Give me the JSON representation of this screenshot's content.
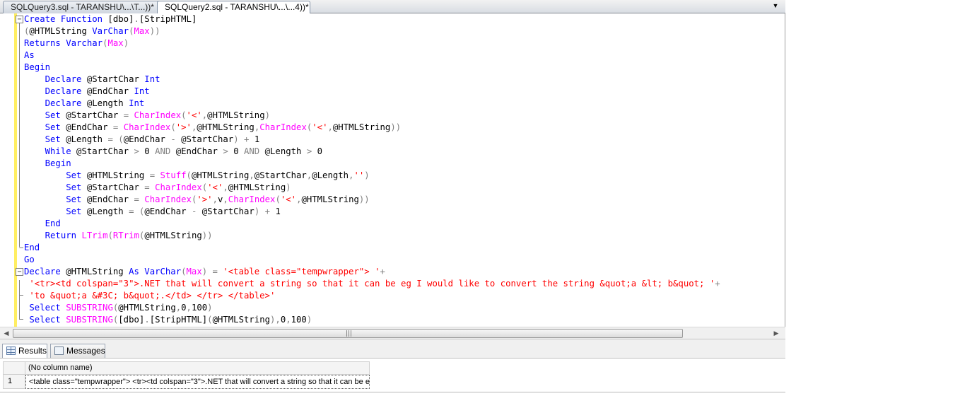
{
  "tabs": [
    {
      "label": "SQLQuery3.sql - TARANSHU\\...\\T...))*",
      "active": false
    },
    {
      "label": "SQLQuery2.sql - TARANSHU\\...\\...4))*",
      "active": true
    }
  ],
  "tab_dropdown": "▼",
  "code_lines": [
    [
      [
        "kw",
        "Create Function "
      ],
      [
        "tx",
        "[dbo]"
      ],
      [
        "op",
        "."
      ],
      [
        "tx",
        "[StripHTML]"
      ]
    ],
    [
      [
        "op",
        "("
      ],
      [
        "tx",
        "@HTMLString "
      ],
      [
        "kw",
        "VarChar"
      ],
      [
        "op",
        "("
      ],
      [
        "fn",
        "Max"
      ],
      [
        "op",
        "))"
      ]
    ],
    [
      [
        "kw",
        "Returns Varchar"
      ],
      [
        "op",
        "("
      ],
      [
        "fn",
        "Max"
      ],
      [
        "op",
        ")"
      ]
    ],
    [
      [
        "kw",
        "As"
      ]
    ],
    [
      [
        "kw",
        "Begin"
      ]
    ],
    [
      [
        "tx",
        "    "
      ],
      [
        "kw",
        "Declare "
      ],
      [
        "tx",
        "@StartChar "
      ],
      [
        "kw",
        "Int"
      ]
    ],
    [
      [
        "tx",
        "    "
      ],
      [
        "kw",
        "Declare "
      ],
      [
        "tx",
        "@EndChar "
      ],
      [
        "kw",
        "Int"
      ]
    ],
    [
      [
        "tx",
        "    "
      ],
      [
        "kw",
        "Declare "
      ],
      [
        "tx",
        "@Length "
      ],
      [
        "kw",
        "Int"
      ]
    ],
    [
      [
        "tx",
        "    "
      ],
      [
        "kw",
        "Set "
      ],
      [
        "tx",
        "@StartChar "
      ],
      [
        "op",
        "= "
      ],
      [
        "fn",
        "CharIndex"
      ],
      [
        "op",
        "("
      ],
      [
        "str",
        "'<'"
      ],
      [
        "op",
        ","
      ],
      [
        "tx",
        "@HTMLString"
      ],
      [
        "op",
        ")"
      ]
    ],
    [
      [
        "tx",
        "    "
      ],
      [
        "kw",
        "Set "
      ],
      [
        "tx",
        "@EndChar "
      ],
      [
        "op",
        "= "
      ],
      [
        "fn",
        "CharIndex"
      ],
      [
        "op",
        "("
      ],
      [
        "str",
        "'>'"
      ],
      [
        "op",
        ","
      ],
      [
        "tx",
        "@HTMLString"
      ],
      [
        "op",
        ","
      ],
      [
        "fn",
        "CharIndex"
      ],
      [
        "op",
        "("
      ],
      [
        "str",
        "'<'"
      ],
      [
        "op",
        ","
      ],
      [
        "tx",
        "@HTMLString"
      ],
      [
        "op",
        "))"
      ]
    ],
    [
      [
        "tx",
        "    "
      ],
      [
        "kw",
        "Set "
      ],
      [
        "tx",
        "@Length "
      ],
      [
        "op",
        "= ("
      ],
      [
        "tx",
        "@EndChar "
      ],
      [
        "op",
        "- "
      ],
      [
        "tx",
        "@StartChar"
      ],
      [
        "op",
        ") + "
      ],
      [
        "tx",
        "1"
      ]
    ],
    [
      [
        "tx",
        "    "
      ],
      [
        "kw",
        "While "
      ],
      [
        "tx",
        "@StartChar "
      ],
      [
        "op",
        "> "
      ],
      [
        "tx",
        "0 "
      ],
      [
        "op",
        "AND "
      ],
      [
        "tx",
        "@EndChar "
      ],
      [
        "op",
        "> "
      ],
      [
        "tx",
        "0 "
      ],
      [
        "op",
        "AND "
      ],
      [
        "tx",
        "@Length "
      ],
      [
        "op",
        "> "
      ],
      [
        "tx",
        "0"
      ]
    ],
    [
      [
        "tx",
        "    "
      ],
      [
        "kw",
        "Begin"
      ]
    ],
    [
      [
        "tx",
        "        "
      ],
      [
        "kw",
        "Set "
      ],
      [
        "tx",
        "@HTMLString "
      ],
      [
        "op",
        "= "
      ],
      [
        "fn",
        "Stuff"
      ],
      [
        "op",
        "("
      ],
      [
        "tx",
        "@HTMLString"
      ],
      [
        "op",
        ","
      ],
      [
        "tx",
        "@StartChar"
      ],
      [
        "op",
        ","
      ],
      [
        "tx",
        "@Length"
      ],
      [
        "op",
        ","
      ],
      [
        "str",
        "''"
      ],
      [
        "op",
        ")"
      ]
    ],
    [
      [
        "tx",
        "        "
      ],
      [
        "kw",
        "Set "
      ],
      [
        "tx",
        "@StartChar "
      ],
      [
        "op",
        "= "
      ],
      [
        "fn",
        "CharIndex"
      ],
      [
        "op",
        "("
      ],
      [
        "str",
        "'<'"
      ],
      [
        "op",
        ","
      ],
      [
        "tx",
        "@HTMLString"
      ],
      [
        "op",
        ")"
      ]
    ],
    [
      [
        "tx",
        "        "
      ],
      [
        "kw",
        "Set "
      ],
      [
        "tx",
        "@EndChar "
      ],
      [
        "op",
        "= "
      ],
      [
        "fn",
        "CharIndex"
      ],
      [
        "op",
        "("
      ],
      [
        "str",
        "'>'"
      ],
      [
        "op",
        ","
      ],
      [
        "tx",
        "v"
      ],
      [
        "op",
        ","
      ],
      [
        "fn",
        "CharIndex"
      ],
      [
        "op",
        "("
      ],
      [
        "str",
        "'<'"
      ],
      [
        "op",
        ","
      ],
      [
        "tx",
        "@HTMLString"
      ],
      [
        "op",
        "))"
      ]
    ],
    [
      [
        "tx",
        "        "
      ],
      [
        "kw",
        "Set "
      ],
      [
        "tx",
        "@Length "
      ],
      [
        "op",
        "= ("
      ],
      [
        "tx",
        "@EndChar "
      ],
      [
        "op",
        "- "
      ],
      [
        "tx",
        "@StartChar"
      ],
      [
        "op",
        ") + "
      ],
      [
        "tx",
        "1"
      ]
    ],
    [
      [
        "tx",
        "    "
      ],
      [
        "kw",
        "End"
      ]
    ],
    [
      [
        "tx",
        "    "
      ],
      [
        "kw",
        "Return "
      ],
      [
        "fn",
        "LTrim"
      ],
      [
        "op",
        "("
      ],
      [
        "fn",
        "RTrim"
      ],
      [
        "op",
        "("
      ],
      [
        "tx",
        "@HTMLString"
      ],
      [
        "op",
        "))"
      ]
    ],
    [
      [
        "kw",
        "End"
      ]
    ],
    [
      [
        "kw",
        "Go"
      ]
    ],
    [
      [
        "kw",
        "Declare "
      ],
      [
        "tx",
        "@HTMLString "
      ],
      [
        "kw",
        "As VarChar"
      ],
      [
        "op",
        "("
      ],
      [
        "fn",
        "Max"
      ],
      [
        "op",
        ") = "
      ],
      [
        "str",
        "'<table class=\"tempwrapper\"> '"
      ],
      [
        "op",
        "+"
      ]
    ],
    [
      [
        "tx",
        " "
      ],
      [
        "str",
        "'<tr><td colspan=\"3\">.NET that will convert a string so that it can be eg I would like to convert the string &quot;a &lt; b&quot; '"
      ],
      [
        "op",
        "+"
      ]
    ],
    [
      [
        "tx",
        " "
      ],
      [
        "str",
        "'to &quot;a &#3C; b&quot;.</td> </tr> </table>'"
      ]
    ],
    [
      [
        "tx",
        " "
      ],
      [
        "kw",
        "Select "
      ],
      [
        "fn",
        "SUBSTRING"
      ],
      [
        "op",
        "("
      ],
      [
        "tx",
        "@HTMLString"
      ],
      [
        "op",
        ","
      ],
      [
        "tx",
        "0"
      ],
      [
        "op",
        ","
      ],
      [
        "tx",
        "100"
      ],
      [
        "op",
        ")"
      ]
    ],
    [
      [
        "tx",
        " "
      ],
      [
        "kw",
        "Select "
      ],
      [
        "fn",
        "SUBSTRING"
      ],
      [
        "op",
        "("
      ],
      [
        "tx",
        "[dbo]"
      ],
      [
        "op",
        "."
      ],
      [
        "tx",
        "[StripHTML]"
      ],
      [
        "op",
        "("
      ],
      [
        "tx",
        "@HTMLString"
      ],
      [
        "op",
        "),"
      ],
      [
        "tx",
        "0"
      ],
      [
        "op",
        ","
      ],
      [
        "tx",
        "100"
      ],
      [
        "op",
        ")"
      ]
    ]
  ],
  "scrollbar": {
    "left_arrow": "◀",
    "right_arrow": "▶",
    "grip": "|||"
  },
  "results_tabs": {
    "results": "Results",
    "messages": "Messages"
  },
  "grid": {
    "column_header": "(No column name)",
    "rows": [
      {
        "num": "1",
        "value": "<table class=\"tempwrapper\"> <tr><td colspan=\"3\">.NET that will convert a string so that it can be e"
      }
    ]
  }
}
